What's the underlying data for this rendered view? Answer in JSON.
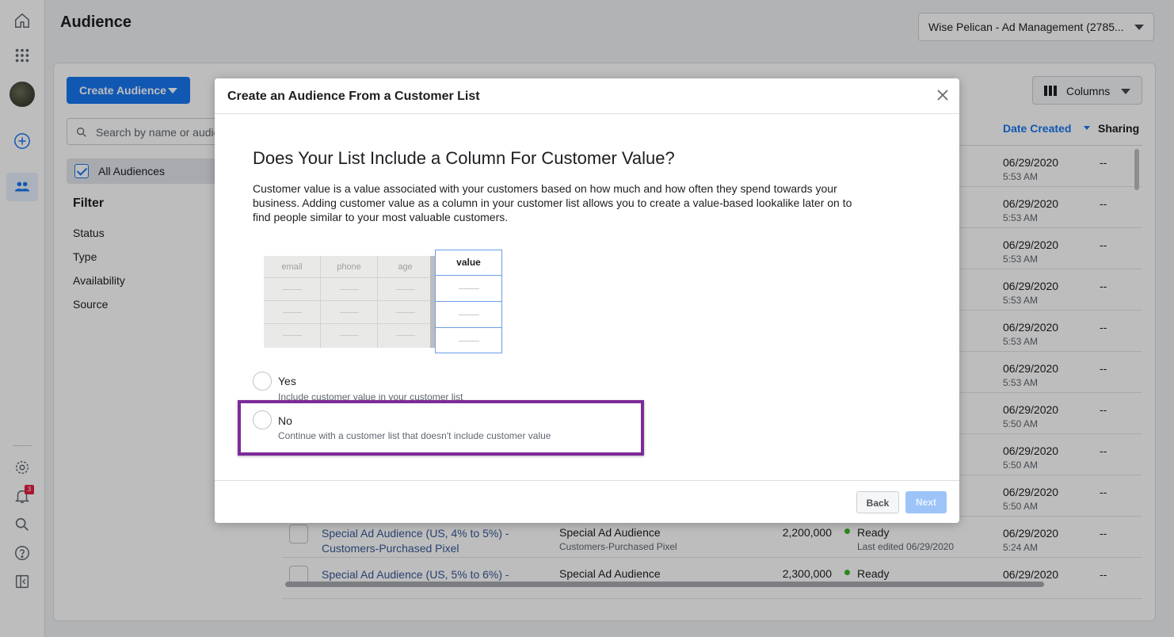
{
  "header": {
    "title": "Audience",
    "account_label": "Wise Pelican - Ad Management (2785..."
  },
  "toolbar": {
    "create_label": "Create Audience",
    "search_placeholder": "Search by name or audie",
    "columns_label": "Columns"
  },
  "sidebar": {
    "all_audiences": "All Audiences",
    "filter_title": "Filter",
    "filters": [
      "Status",
      "Type",
      "Availability",
      "Source"
    ]
  },
  "rail": {
    "notification_count": "3"
  },
  "table": {
    "headers": {
      "date_created": "Date Created",
      "sharing": "Sharing"
    },
    "rows": [
      {
        "date": "06/29/2020",
        "time": "5:53 AM",
        "sharing": "--"
      },
      {
        "date": "06/29/2020",
        "time": "5:53 AM",
        "sharing": "--"
      },
      {
        "date": "06/29/2020",
        "time": "5:53 AM",
        "sharing": "--"
      },
      {
        "date": "06/29/2020",
        "time": "5:53 AM",
        "sharing": "--"
      },
      {
        "date": "06/29/2020",
        "time": "5:53 AM",
        "sharing": "--"
      },
      {
        "date": "06/29/2020",
        "time": "5:53 AM",
        "sharing": "--"
      },
      {
        "date": "06/29/2020",
        "time": "5:50 AM",
        "sharing": "--"
      },
      {
        "date": "06/29/2020",
        "time": "5:50 AM",
        "sharing": "--"
      },
      {
        "date": "06/29/2020",
        "time": "5:50 AM",
        "sharing": "--"
      },
      {
        "name": "Special Ad Audience (US, 4% to 5%) - Customers-Purchased Pixel",
        "type": "Special Ad Audience",
        "type_sub": "Customers-Purchased Pixel",
        "size": "2,200,000",
        "availability": "Ready",
        "availability_sub": "Last edited 06/29/2020",
        "date": "06/29/2020",
        "time": "5:24 AM",
        "sharing": "--"
      },
      {
        "name": "Special Ad Audience (US, 5% to 6%) -",
        "type": "Special Ad Audience",
        "size": "2,300,000",
        "availability": "Ready",
        "date": "06/29/2020",
        "sharing": "--"
      }
    ]
  },
  "modal": {
    "title": "Create an Audience From a Customer List",
    "question": "Does Your List Include a Column For Customer Value?",
    "description": "Customer value is a value associated with your customers based on how much and how often they spend towards your business. Adding customer value as a column in your customer list allows you to create a value-based lookalike later on to find people similar to your most valuable customers.",
    "illustration": {
      "columns": [
        "email",
        "phone",
        "age"
      ],
      "value_column": "value"
    },
    "options": [
      {
        "label": "Yes",
        "sub": "Include customer value in your customer list"
      },
      {
        "label": "No",
        "sub": "Continue with a customer list that doesn't include customer value"
      }
    ],
    "back_label": "Back",
    "next_label": "Next"
  },
  "colors": {
    "primary": "#1877f2",
    "highlight_border": "#7d2b98",
    "ready_dot": "#42b72a"
  }
}
